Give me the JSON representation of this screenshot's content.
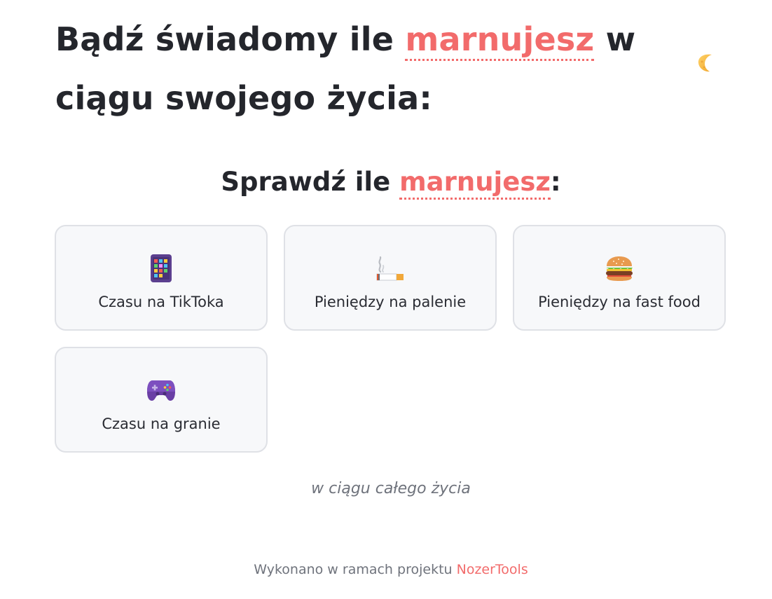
{
  "hero": {
    "prefix": "Bądź świadomy ile ",
    "accent": "marnujesz",
    "suffix": " w ciągu swojego życia:"
  },
  "theme_toggle": {
    "icon": "moon-icon"
  },
  "section": {
    "prefix": "Sprawdź ile ",
    "accent": "marnujesz",
    "suffix": ":"
  },
  "cards": [
    {
      "label": "Czasu na TikToka",
      "icon": "phone-icon"
    },
    {
      "label": "Pieniędzy na palenie",
      "icon": "cigarette-icon"
    },
    {
      "label": "Pieniędzy na fast food",
      "icon": "burger-icon"
    },
    {
      "label": "Czasu na granie",
      "icon": "gamepad-icon"
    }
  ],
  "lifetime_note": "w ciągu całego życia",
  "footer": {
    "text": "Wykonano w ramach projektu ",
    "link": "NozerTools"
  },
  "colors": {
    "accent": "#f26b6b",
    "text": "#24262c",
    "card_bg": "#f7f8fa",
    "card_border": "#dfe1e6",
    "muted": "#6f737c"
  }
}
